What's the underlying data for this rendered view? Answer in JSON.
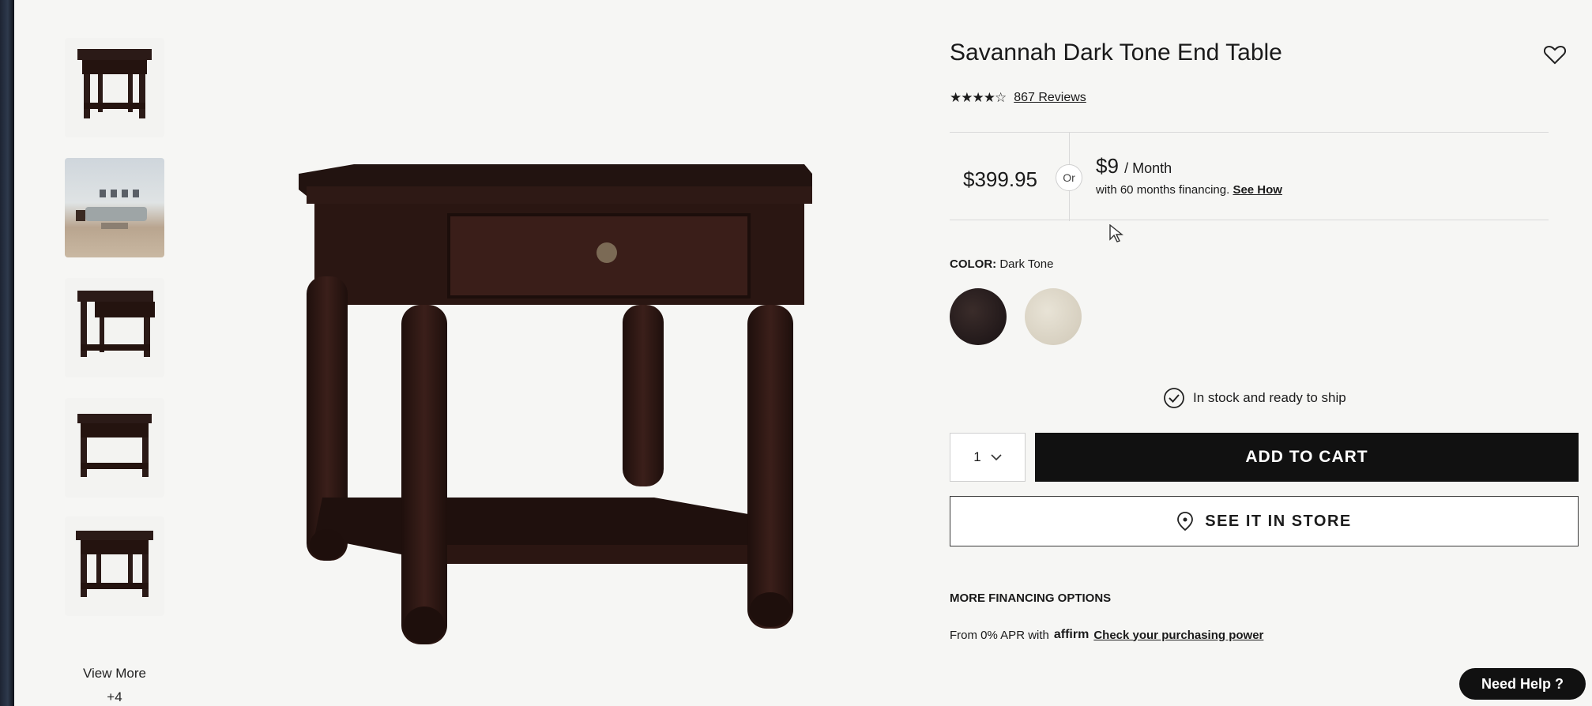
{
  "product": {
    "title": "Savannah Dark Tone End Table",
    "rating_stars": "★★★★☆",
    "reviews_label": "867 Reviews"
  },
  "pricing": {
    "price": "$399.95",
    "or_label": "Or",
    "monthly_amount": "$9",
    "monthly_unit": "/ Month",
    "financing_text": "with 60 months financing.",
    "see_how_label": "See How"
  },
  "color": {
    "label": "COLOR:",
    "selected": "Dark Tone",
    "swatches": [
      "#2a1f1e",
      "#ddd6c8"
    ]
  },
  "stock_text": "In stock and ready to ship",
  "quantity": "1",
  "buttons": {
    "add_to_cart": "ADD TO CART",
    "see_in_store": "SEE IT IN STORE",
    "need_help": "Need Help ?"
  },
  "financing_options": {
    "heading": "MORE FINANCING OPTIONS",
    "text": "From 0% APR with",
    "affirm": "affirm",
    "link": "Check your purchasing power"
  },
  "gallery": {
    "view_more": "View More",
    "more_count": "+4"
  },
  "colors": {
    "button_bg": "#111111",
    "wood": "#2b1a17"
  }
}
